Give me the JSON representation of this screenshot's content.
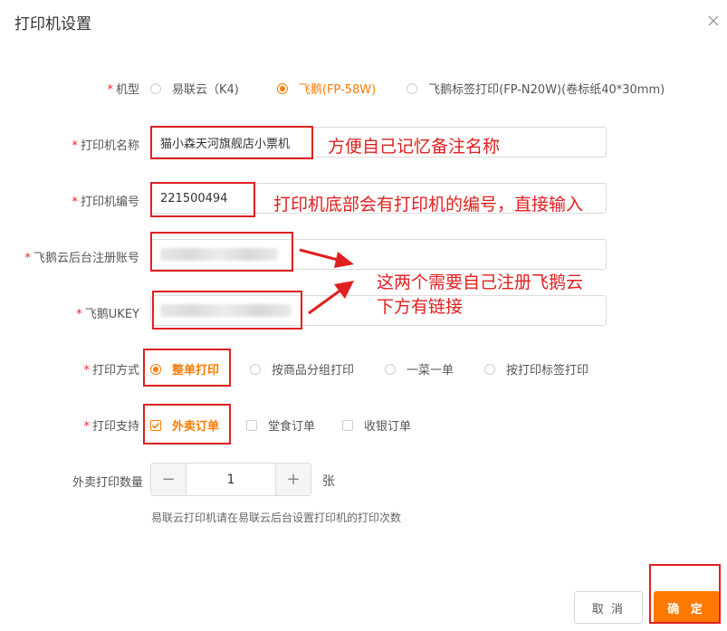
{
  "dialog": {
    "title": "打印机设置"
  },
  "fields": {
    "model": {
      "label": "机型",
      "options": [
        {
          "label": "易联云（K4)",
          "selected": false
        },
        {
          "label": "飞鹅(FP-58W)",
          "selected": true
        },
        {
          "label": "飞鹅标签打印(FP-N20W)(卷标纸40*30mm)",
          "selected": false
        }
      ]
    },
    "printer_name": {
      "label": "打印机名称",
      "value": "猫小森天河旗舰店小票机"
    },
    "printer_number": {
      "label": "打印机编号",
      "value": "221500494"
    },
    "feie_account": {
      "label": "飞鹅云后台注册账号"
    },
    "feie_ukey": {
      "label": "飞鹅UKEY"
    },
    "print_mode": {
      "label": "打印方式",
      "options": [
        {
          "label": "整单打印",
          "selected": true
        },
        {
          "label": "按商品分组打印",
          "selected": false
        },
        {
          "label": "一菜一单",
          "selected": false
        },
        {
          "label": "按打印标签打印",
          "selected": false
        }
      ]
    },
    "print_support": {
      "label": "打印支持",
      "options": [
        {
          "label": "外卖订单",
          "checked": true
        },
        {
          "label": "堂食订单",
          "checked": false
        },
        {
          "label": "收银订单",
          "checked": false
        }
      ]
    },
    "takeout_count": {
      "label": "外卖打印数量",
      "value": "1",
      "unit": "张",
      "minus": "−",
      "plus": "+",
      "hint": "易联云打印机请在易联云后台设置打印机的打印次数"
    }
  },
  "annotations": {
    "name_note": "方便自己记忆备注名称",
    "number_note": "打印机底部会有打印机的编号，直接输入",
    "register_note_line1": "这两个需要自己注册飞鹅云",
    "register_note_line2": "下方有链接",
    "color": "#e02020"
  },
  "footer": {
    "cancel_label": "取 消",
    "confirm_label": "确 定"
  },
  "colors": {
    "accent": "#ff7a00",
    "required": "#f5222d",
    "annotation": "#e02020"
  }
}
